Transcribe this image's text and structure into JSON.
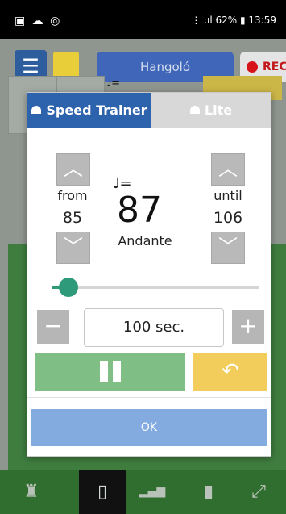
{
  "status_bar": {
    "left_icons": "▣ ☁ ◎",
    "right_text": "⋮ .ıl 62% ▮ 13:59"
  },
  "top_bar": {
    "menu_icon": "☰",
    "title": "Hangoló",
    "rec_label": "REC"
  },
  "background": {
    "note_symbol": "♩="
  },
  "modal": {
    "tabs": [
      {
        "label": "Speed Trainer",
        "icon": "lamp-icon",
        "active": true
      },
      {
        "label": "Lite",
        "icon": "lamp-icon",
        "active": false
      }
    ],
    "from_label": "from",
    "from_value": "85",
    "until_label": "until",
    "until_value": "106",
    "note_symbol": "♩=",
    "bpm_value": "87",
    "tempo_name": "Andante",
    "up_glyph": "︿",
    "down_glyph": "﹀",
    "slider_progress": 0.08,
    "minus_glyph": "−",
    "plus_glyph": "+",
    "duration_value": "100 sec.",
    "reset_glyph": "↶",
    "ok_label": "OK"
  },
  "bottom_nav": [
    {
      "icon": "torch-icon",
      "glyph": "♜",
      "active": false
    },
    {
      "icon": "phone-vibrate-icon",
      "glyph": "▯",
      "active": true
    },
    {
      "icon": "bars-chart-icon",
      "glyph": "▂▄▆",
      "active": false
    },
    {
      "icon": "battery-settings-icon",
      "glyph": "▮",
      "active": false
    },
    {
      "icon": "fullscreen-icon",
      "glyph": "⤢",
      "active": false
    }
  ],
  "colors": {
    "primary_blue": "#2d63ad",
    "accent_green": "#2f9a7a",
    "pause_green": "#7fbf85",
    "reset_yellow": "#f2cd5b",
    "ok_blue": "#83abe0",
    "rec_red": "#d8141b"
  }
}
